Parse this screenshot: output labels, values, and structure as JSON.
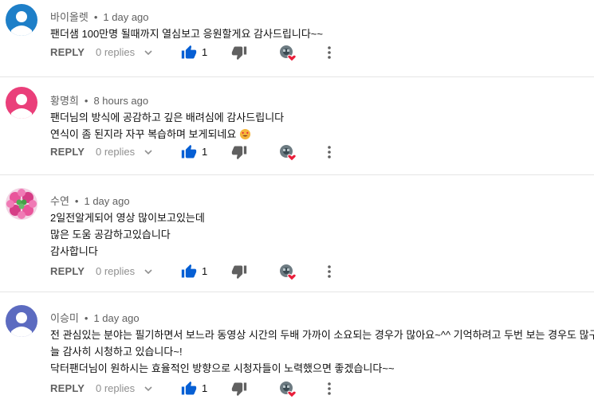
{
  "comments": [
    {
      "author": "바이올렛",
      "time": "1 day ago",
      "avatar_color": "#1e7fc8",
      "lines": [
        "팬더샘 100만명 될때까지 열심보고 응원할게요 감사드립니다~~"
      ],
      "reply_label": "REPLY",
      "replies_label": "0 replies",
      "likes": "1"
    },
    {
      "author": "황명희",
      "time": "8 hours ago",
      "avatar_color": "#ea3f7a",
      "lines": [
        "팬더님의 방식에 공감하고 깊은 배려심에 감사드립니다",
        "연식이 좀 된지라 자꾸 복습하며 보게되네요"
      ],
      "reply_label": "REPLY",
      "replies_label": "0 replies",
      "likes": "1"
    },
    {
      "author": "수연",
      "time": "1 day ago",
      "avatar_color": "#e9559b",
      "lines": [
        "2일전알게되어 영상 많이보고있는데",
        "많은 도움 공감하고있습니다",
        "감사합니다"
      ],
      "reply_label": "REPLY",
      "replies_label": "0 replies",
      "likes": "1"
    },
    {
      "author": "이승미",
      "time": "1 day ago",
      "avatar_color": "#5c6bc0",
      "lines": [
        "전 관심있는 분야는  필기하면서 보느라 동영상 시간의 두배 가까이 소요되는 경우가 많아요~^^ 기억하려고 두번 보는 경우도 많구요♡",
        "늘 감사히 시청하고 있습니다~!",
        "닥터팬더님이 원하시는 효율적인  방향으로 시청자들이 노력했으면 좋겠습니다~~"
      ],
      "reply_label": "REPLY",
      "replies_label": "0 replies",
      "likes": "1"
    }
  ],
  "icons": {
    "like": "thumbs-up-icon",
    "dislike": "thumbs-down-icon",
    "creator_heart": "creator-heart-icon",
    "more": "more-vert-icon",
    "expand": "chevron-down-icon"
  },
  "colors": {
    "like_blue": "#065fd4",
    "heart_red": "#e91e3a",
    "meta_gray": "#606060"
  }
}
